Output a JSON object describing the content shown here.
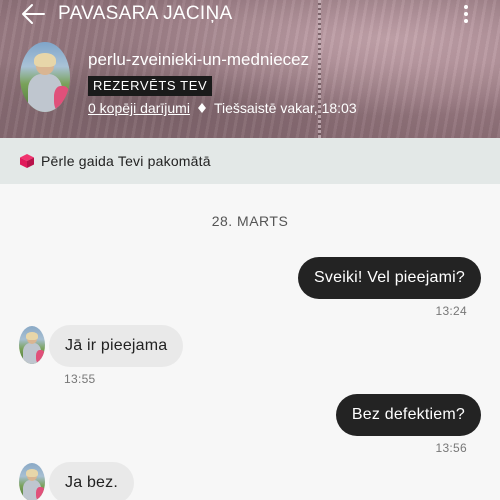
{
  "header": {
    "title": "PAVASARA JACIŅA",
    "back_icon": "arrow-left-icon",
    "more_icon": "more-vertical-icon"
  },
  "seller": {
    "username": "perlu-zveinieki-un-medniecez",
    "badge": "REZERVĒTS TEV",
    "deals": "0 kopēji darījumi",
    "separator_icon": "diamond-icon",
    "online_status": "Tiešsaistē vakar, 18:03"
  },
  "banner": {
    "icon": "package-icon",
    "icon_color": "#e0195a",
    "text": "Pērle gaida Tevi pakomātā"
  },
  "chat": {
    "date": "28. MARTS",
    "messages": [
      {
        "direction": "out",
        "text": "Sveiki! Vel pieejami?",
        "time": "13:24"
      },
      {
        "direction": "in",
        "text": "Jā ir pieejama",
        "time": "13:55"
      },
      {
        "direction": "out",
        "text": "Bez defektiem?",
        "time": "13:56"
      },
      {
        "direction": "in",
        "text": "Ja bez.",
        "time": ""
      }
    ]
  },
  "colors": {
    "outgoing_bubble": "#232323",
    "incoming_bubble": "#e9e9e9",
    "banner_bg": "#e3e8e7",
    "badge_bg": "#1a1a1a"
  }
}
